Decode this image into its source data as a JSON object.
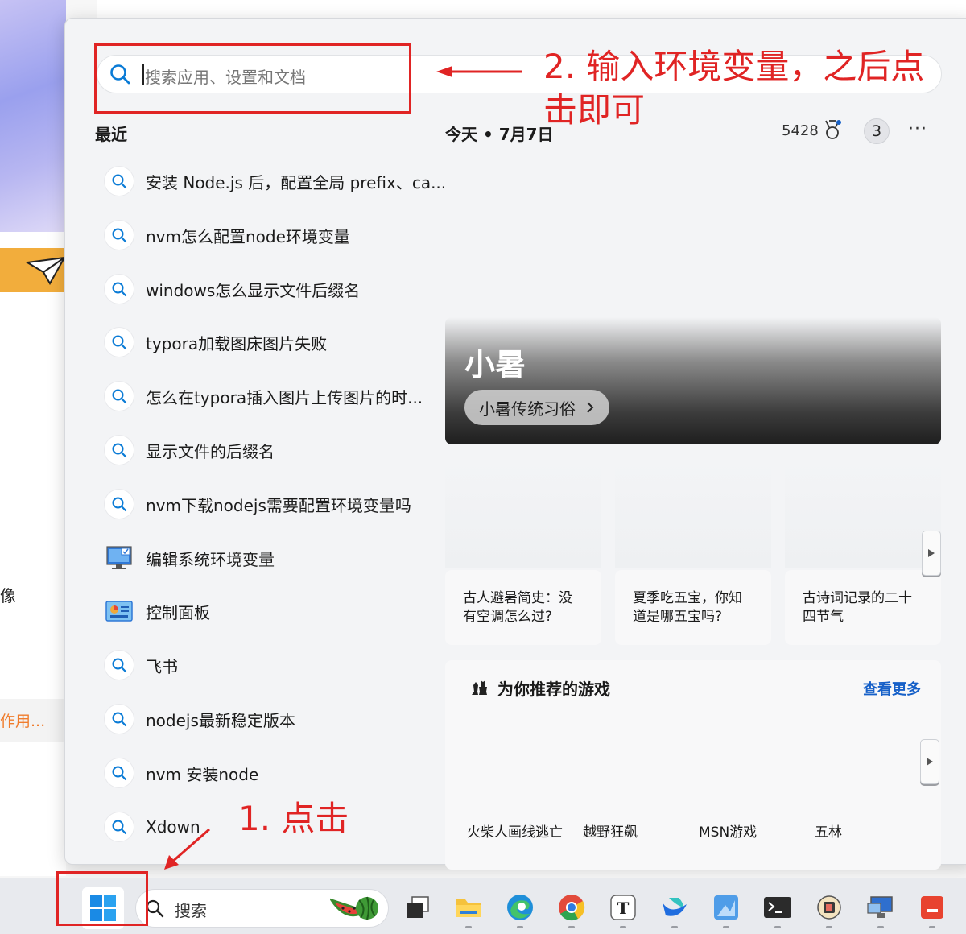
{
  "search": {
    "placeholder": "搜索应用、设置和文档"
  },
  "recent": {
    "title": "最近",
    "items": [
      {
        "label": "安装 Node.js 后，配置全局 prefix、ca...",
        "icon": "search-icon"
      },
      {
        "label": "nvm怎么配置node环境变量",
        "icon": "search-icon"
      },
      {
        "label": "windows怎么显示文件后缀名",
        "icon": "search-icon"
      },
      {
        "label": "typora加载图床图片失败",
        "icon": "search-icon"
      },
      {
        "label": "怎么在typora插入图片上传图片的时...",
        "icon": "search-icon"
      },
      {
        "label": "显示文件的后缀名",
        "icon": "search-icon"
      },
      {
        "label": "nvm下载nodejs需要配置环境变量吗",
        "icon": "search-icon"
      },
      {
        "label": "编辑系统环境变量",
        "icon": "system-settings-icon"
      },
      {
        "label": "控制面板",
        "icon": "control-panel-icon"
      },
      {
        "label": "飞书",
        "icon": "search-icon"
      },
      {
        "label": "nodejs最新稳定版本",
        "icon": "search-icon"
      },
      {
        "label": "nvm 安装node",
        "icon": "search-icon"
      },
      {
        "label": "Xdown",
        "icon": "search-icon"
      }
    ]
  },
  "header": {
    "today": "今天 • 7月7日",
    "points": "5428",
    "badge": "3",
    "more": "···"
  },
  "hero": {
    "title": "小暑",
    "pill": "小暑传统习俗"
  },
  "news": [
    {
      "text": "古人避暑简史：没有空调怎么过?"
    },
    {
      "text": "夏季吃五宝，你知道是哪五宝吗?"
    },
    {
      "text": "古诗词记录的二十四节气"
    }
  ],
  "games": {
    "title": "为你推荐的游戏",
    "more": "查看更多",
    "items": [
      "火柴人画线逃亡",
      "越野狂飙",
      "MSN游戏",
      "五林"
    ]
  },
  "background": {
    "left_text_1": "缘像",
    "left_text_2": "作用..."
  },
  "annotations": {
    "step2": "2. 输入环境变量，之后点击即可",
    "step1": "1. 点击"
  },
  "taskbar": {
    "search_label": "搜索"
  },
  "colors": {
    "annotation": "#e02424",
    "link": "#1660c8",
    "accent": "#0a7bd6"
  }
}
